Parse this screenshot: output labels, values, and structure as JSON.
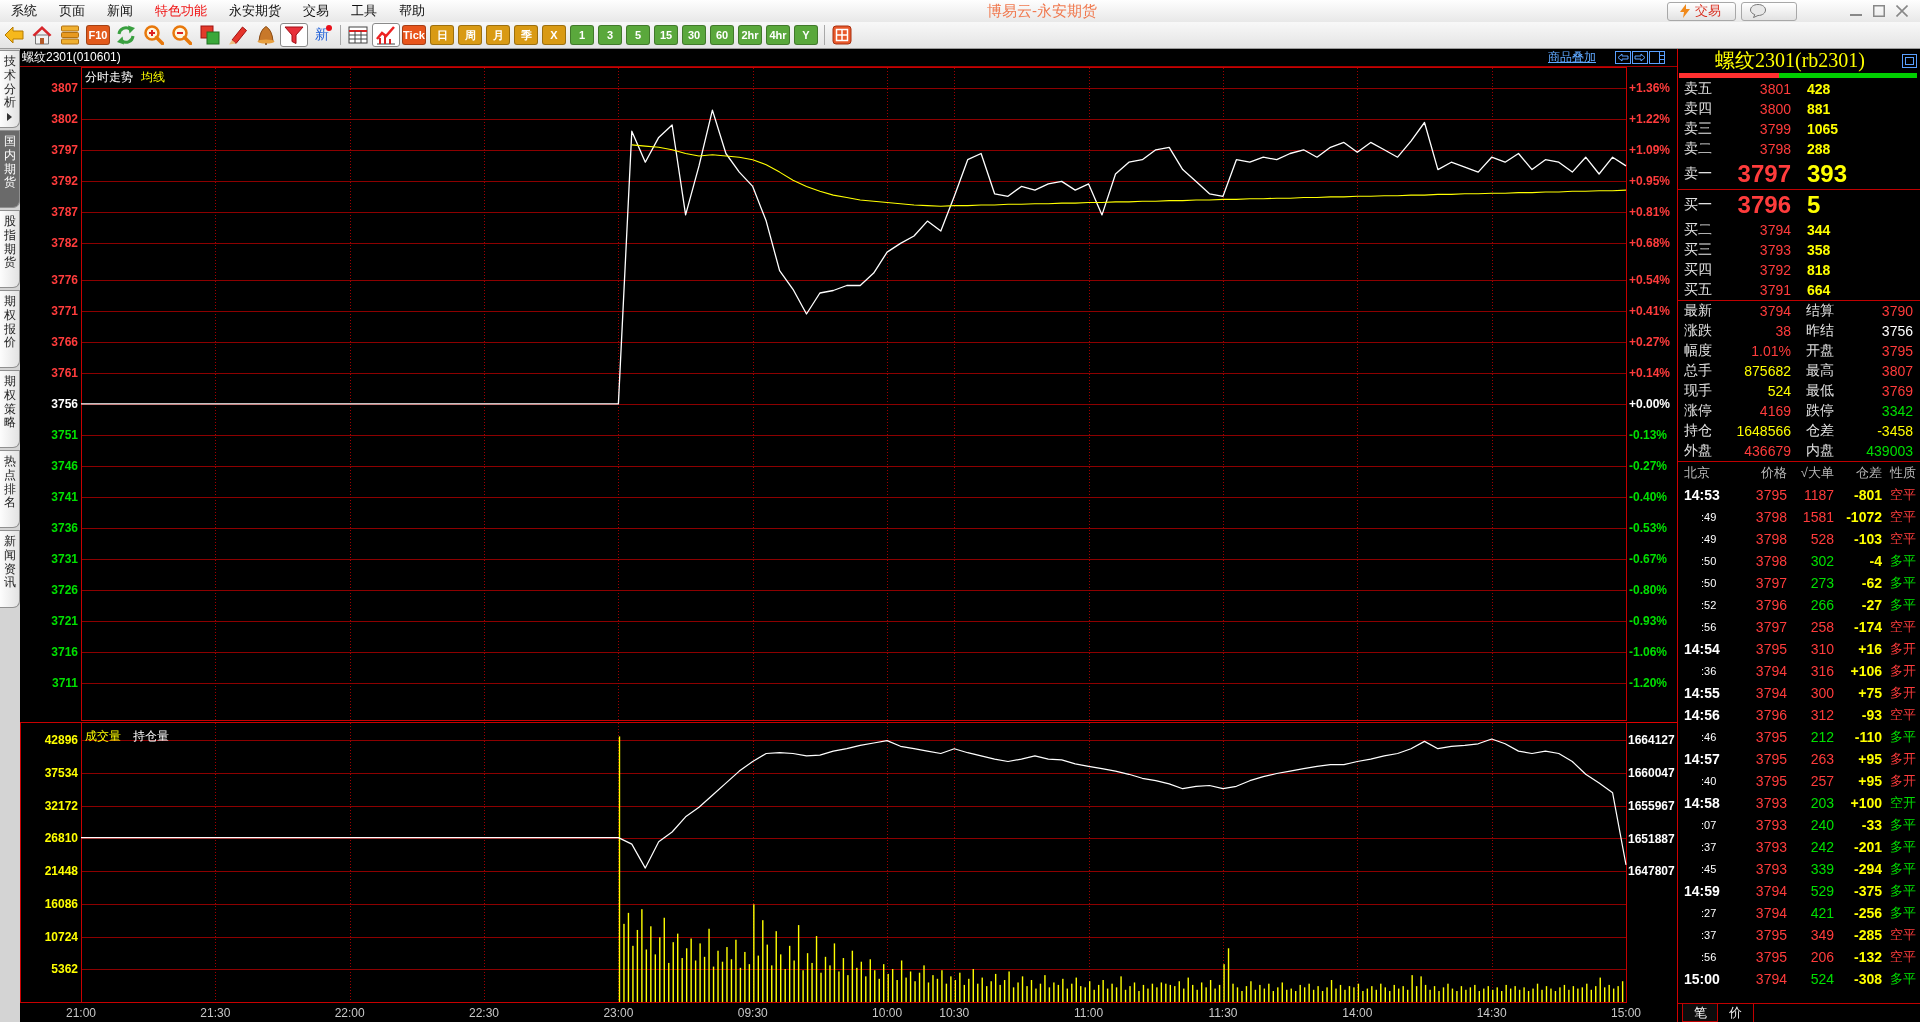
{
  "menu_bar": {
    "items": [
      {
        "label": "系统",
        "highlighted": false
      },
      {
        "label": "页面",
        "highlighted": false
      },
      {
        "label": "新闻",
        "highlighted": false
      },
      {
        "label": "特色功能",
        "highlighted": true
      },
      {
        "label": "永安期货",
        "highlighted": false
      },
      {
        "label": "交易",
        "highlighted": false
      },
      {
        "label": "工具",
        "highlighted": false
      },
      {
        "label": "帮助",
        "highlighted": false
      }
    ],
    "app_title": "博易云-永安期货",
    "trade_button": "交易"
  },
  "toolbar": {
    "groups": [
      [
        {
          "kind": "back",
          "selected": false
        },
        {
          "kind": "home",
          "selected": false
        },
        {
          "kind": "books",
          "selected": false
        },
        {
          "kind": "tile",
          "label": "F10",
          "color": "#e25a1c",
          "selected": false
        },
        {
          "kind": "refresh",
          "selected": false
        },
        {
          "kind": "zoomin",
          "selected": false
        },
        {
          "kind": "zoomout",
          "selected": false
        },
        {
          "kind": "windows",
          "selected": false
        },
        {
          "kind": "pen",
          "selected": false
        },
        {
          "kind": "bell",
          "selected": false
        },
        {
          "kind": "filter",
          "selected": true
        },
        {
          "kind": "news",
          "label": "新",
          "badge": true,
          "selected": false
        }
      ],
      [
        {
          "kind": "table",
          "selected": false
        },
        {
          "kind": "chart",
          "selected": true
        },
        {
          "kind": "tile",
          "label": "Tick",
          "color": "#e8551c",
          "selected": false
        },
        {
          "kind": "tile",
          "label": "日",
          "color": "#d99a14",
          "selected": false
        },
        {
          "kind": "tile",
          "label": "周",
          "color": "#d99a14",
          "selected": false
        },
        {
          "kind": "tile",
          "label": "月",
          "color": "#d99a14",
          "selected": false
        },
        {
          "kind": "tile",
          "label": "季",
          "color": "#d99a14",
          "selected": false
        },
        {
          "kind": "tile",
          "label": "X",
          "color": "#d99a14",
          "selected": false
        },
        {
          "kind": "tile",
          "label": "1",
          "color": "#5aa83c",
          "selected": false
        },
        {
          "kind": "tile",
          "label": "3",
          "color": "#5aa83c",
          "selected": false
        },
        {
          "kind": "tile",
          "label": "5",
          "color": "#5aa83c",
          "selected": false
        },
        {
          "kind": "tile",
          "label": "15",
          "color": "#5aa83c",
          "selected": false
        },
        {
          "kind": "tile",
          "label": "30",
          "color": "#5aa83c",
          "selected": false
        },
        {
          "kind": "tile",
          "label": "60",
          "color": "#5aa83c",
          "selected": false
        },
        {
          "kind": "tile",
          "label": "2hr",
          "color": "#5aa83c",
          "selected": false
        },
        {
          "kind": "tile",
          "label": "4hr",
          "color": "#5aa83c",
          "selected": false
        },
        {
          "kind": "tile",
          "label": "Y",
          "color": "#5aa83c",
          "selected": false
        }
      ],
      [
        {
          "kind": "grid",
          "selected": false
        }
      ]
    ]
  },
  "side_tabs": [
    {
      "label": "技术分析",
      "selected": false,
      "has_arrow": true
    },
    {
      "label": "国内期货",
      "selected": true,
      "has_arrow": false
    },
    {
      "label": "股指期货",
      "selected": false,
      "has_arrow": false
    },
    {
      "label": "期权报价",
      "selected": false,
      "has_arrow": false
    },
    {
      "label": "期权策略",
      "selected": false,
      "has_arrow": false
    },
    {
      "label": "热点排名",
      "selected": false,
      "has_arrow": false
    },
    {
      "label": "新闻资讯",
      "selected": false,
      "has_arrow": false
    }
  ],
  "chart_header": {
    "title": "螺纹2301(010601)",
    "overlay_link": "商品叠加"
  },
  "price_chart": {
    "chart_data": {
      "type": "line",
      "grid": true,
      "ylim": [
        3705,
        3810.2
      ],
      "yticks": [
        3807,
        3802,
        3797,
        3792,
        3787,
        3782,
        3776,
        3771,
        3766,
        3761,
        3756,
        3751,
        3746,
        3741,
        3736,
        3731,
        3726,
        3721,
        3716,
        3711
      ],
      "categories": [
        null,
        null,
        null,
        null,
        null,
        null,
        null,
        null,
        null,
        null,
        null,
        null,
        null,
        null,
        null,
        null,
        null,
        null,
        null,
        null,
        null,
        null,
        null,
        null,
        null,
        null,
        null,
        null,
        null,
        null,
        null,
        null,
        null,
        null,
        null,
        null,
        null,
        null,
        null,
        null,
        null,
        null,
        null,
        null,
        null,
        null,
        null,
        null,
        null,
        null,
        null,
        null,
        null,
        null,
        null,
        null,
        null,
        null,
        null,
        null,
        null,
        null,
        null,
        null,
        null,
        null,
        null,
        null,
        null,
        null,
        null,
        null,
        null,
        null,
        null,
        null,
        null,
        null,
        null,
        null,
        null,
        null,
        null,
        null,
        null,
        null,
        null,
        null,
        null,
        null,
        null,
        null,
        null,
        null,
        null,
        null,
        null,
        null,
        null,
        null,
        null,
        null,
        null,
        null,
        null,
        null,
        null,
        null,
        null,
        null,
        null,
        null,
        null,
        null,
        null,
        null
      ],
      "series": [
        {
          "name": "分时走势",
          "color": "#ffffff",
          "values": [
            3756,
            3756,
            3756,
            3756,
            3756,
            3756,
            3756,
            3756,
            3756,
            3756,
            3756,
            3756,
            3756,
            3756,
            3756,
            3756,
            3756,
            3756,
            3756,
            3756,
            3756,
            3756,
            3756,
            3756,
            3756,
            3756,
            3756,
            3756,
            3756,
            3756,
            3756,
            3756,
            3756,
            3756,
            3756,
            3756,
            3756,
            3756,
            3756,
            3756,
            3756,
            3800.0,
            3795.0,
            3799.0,
            3801.0,
            3786.5,
            3794.4,
            3803.4,
            3796.4,
            3793.4,
            3791.1,
            3785.5,
            3777.5,
            3774.5,
            3770.5,
            3773.9,
            3774.3,
            3775.1,
            3775.1,
            3777.1,
            3780.5,
            3781.9,
            3783.1,
            3785.5,
            3783.9,
            3789.5,
            3795.4,
            3796.4,
            3789.9,
            3789.5,
            3791.1,
            3790.5,
            3791.5,
            3791.9,
            3790.5,
            3791.5,
            3786.5,
            3793.1,
            3795.0,
            3795.4,
            3797.0,
            3797.4,
            3793.8,
            3791.9,
            3789.9,
            3789.5,
            3795.4,
            3795.0,
            3795.8,
            3795.4,
            3796.4,
            3797.0,
            3795.8,
            3797.4,
            3798.2,
            3796.6,
            3798.2,
            3797.0,
            3795.8,
            3798.4,
            3801.4,
            3793.8,
            3795.0,
            3794.2,
            3793.4,
            3795.8,
            3795.0,
            3796.4,
            3793.8,
            3795.4,
            3795.0,
            3793.4,
            3795.8,
            3793.1,
            3795.8,
            3794.4
          ]
        },
        {
          "name": "均线",
          "color": "#ffff00",
          "values": [
            null,
            null,
            null,
            null,
            null,
            null,
            null,
            null,
            null,
            null,
            null,
            null,
            null,
            null,
            null,
            null,
            null,
            null,
            null,
            null,
            null,
            null,
            null,
            null,
            null,
            null,
            null,
            null,
            null,
            null,
            null,
            null,
            null,
            null,
            null,
            null,
            null,
            null,
            null,
            null,
            null,
            3797.8,
            3797.6,
            3797.4,
            3797.0,
            3796.4,
            3796.0,
            3796.2,
            3796.0,
            3795.8,
            3795.4,
            3794.6,
            3793.4,
            3792.1,
            3791.1,
            3790.3,
            3789.7,
            3789.3,
            3788.9,
            3788.7,
            3788.5,
            3788.3,
            3788.1,
            3788.0,
            3787.9,
            3788.0,
            3788.0,
            3788.1,
            3788.1,
            3788.2,
            3788.2,
            3788.3,
            3788.3,
            3788.4,
            3788.4,
            3788.5,
            3788.5,
            3788.6,
            3788.6,
            3788.7,
            3788.7,
            3788.8,
            3788.8,
            3788.9,
            3788.9,
            3789.0,
            3789.0,
            3789.1,
            3789.1,
            3789.2,
            3789.2,
            3789.3,
            3789.3,
            3789.4,
            3789.4,
            3789.5,
            3789.5,
            3789.6,
            3789.6,
            3789.7,
            3789.7,
            3789.8,
            3789.8,
            3789.9,
            3789.9,
            3790.0,
            3790.0,
            3790.1,
            3790.1,
            3790.2,
            3790.2,
            3790.3,
            3790.3,
            3790.4,
            3790.4,
            3790.5
          ]
        }
      ]
    },
    "percent_axis": [
      {
        "label": "+1.36%",
        "color": "#ff3c3c"
      },
      {
        "label": "+1.22%",
        "color": "#ff3c3c"
      },
      {
        "label": "+1.09%",
        "color": "#ff3c3c"
      },
      {
        "label": "+0.95%",
        "color": "#ff3c3c"
      },
      {
        "label": "+0.81%",
        "color": "#ff3c3c"
      },
      {
        "label": "+0.68%",
        "color": "#ff3c3c"
      },
      {
        "label": "+0.54%",
        "color": "#ff3c3c"
      },
      {
        "label": "+0.41%",
        "color": "#ff3c3c"
      },
      {
        "label": "+0.27%",
        "color": "#ff3c3c"
      },
      {
        "label": "+0.14%",
        "color": "#ff3c3c"
      },
      {
        "label": "+0.00%",
        "color": "#ffffff"
      },
      {
        "label": "-0.13%",
        "color": "#00e000"
      },
      {
        "label": "-0.27%",
        "color": "#00e000"
      },
      {
        "label": "-0.40%",
        "color": "#00e000"
      },
      {
        "label": "-0.53%",
        "color": "#00e000"
      },
      {
        "label": "-0.67%",
        "color": "#00e000"
      },
      {
        "label": "-0.80%",
        "color": "#00e000"
      },
      {
        "label": "-0.93%",
        "color": "#00e000"
      },
      {
        "label": "-1.06%",
        "color": "#00e000"
      },
      {
        "label": "-1.20%",
        "color": "#00e000"
      }
    ]
  },
  "volume_chart": {
    "chart_data": {
      "type": "bar",
      "grid": true,
      "ylim": [
        0,
        45700
      ],
      "categories": [
        "21:00",
        null,
        null,
        null,
        null,
        null,
        null,
        null,
        null,
        null,
        null,
        null,
        null,
        null,
        null,
        null,
        null,
        null,
        null,
        null,
        null,
        null,
        null,
        null,
        null,
        null,
        null,
        null,
        null,
        null,
        "21:30",
        null,
        null,
        null,
        null,
        null,
        null,
        null,
        null,
        null,
        null,
        null,
        null,
        null,
        null,
        null,
        null,
        null,
        null,
        null,
        null,
        null,
        null,
        null,
        null,
        null,
        null,
        null,
        null,
        null,
        "22:00",
        null,
        null,
        null,
        null,
        null,
        null,
        null,
        null,
        null,
        null,
        null,
        null,
        null,
        null,
        null,
        null,
        null,
        null,
        null,
        null,
        null,
        null,
        null,
        null,
        null,
        null,
        null,
        null,
        null,
        "22:30",
        null,
        null,
        null,
        null,
        null,
        null,
        null,
        null,
        null,
        null,
        null,
        null,
        null,
        null,
        null,
        null,
        null,
        null,
        null,
        null,
        null,
        null,
        null,
        null,
        null,
        null,
        null,
        null,
        null,
        "23:00",
        null,
        null,
        null,
        null,
        null,
        null,
        null,
        null,
        null,
        null,
        null,
        null,
        null,
        null,
        null,
        null,
        null,
        null,
        null,
        null,
        null,
        null,
        null,
        null,
        null,
        null,
        null,
        null,
        null,
        "09:30",
        null,
        null,
        null,
        null,
        null,
        null,
        null,
        null,
        null,
        null,
        null,
        null,
        null,
        null,
        null,
        null,
        null,
        null,
        null,
        null,
        null,
        null,
        null,
        null,
        null,
        null,
        null,
        null,
        null,
        "10:00",
        null,
        null,
        null,
        null,
        null,
        null,
        null,
        null,
        null,
        null,
        null,
        null,
        null,
        null,
        "10:30",
        null,
        null,
        null,
        null,
        null,
        null,
        null,
        null,
        null,
        null,
        null,
        null,
        null,
        null,
        null,
        null,
        null,
        null,
        null,
        null,
        null,
        null,
        null,
        null,
        null,
        null,
        null,
        null,
        null,
        "11:00",
        null,
        null,
        null,
        null,
        null,
        null,
        null,
        null,
        null,
        null,
        null,
        null,
        null,
        null,
        null,
        null,
        null,
        null,
        null,
        null,
        null,
        null,
        null,
        null,
        null,
        null,
        null,
        null,
        null,
        "11:30",
        null,
        null,
        null,
        null,
        null,
        null,
        null,
        null,
        null,
        null,
        null,
        null,
        null,
        null,
        null,
        null,
        null,
        null,
        null,
        null,
        null,
        null,
        null,
        null,
        null,
        null,
        null,
        null,
        null,
        "14:00",
        null,
        null,
        null,
        null,
        null,
        null,
        null,
        null,
        null,
        null,
        null,
        null,
        null,
        null,
        null,
        null,
        null,
        null,
        null,
        null,
        null,
        null,
        null,
        null,
        null,
        null,
        null,
        null,
        null,
        "14:30",
        null,
        null,
        null,
        null,
        null,
        null,
        null,
        null,
        null,
        null,
        null,
        null,
        null,
        null,
        null,
        null,
        null,
        null,
        null,
        null,
        null,
        null,
        null,
        null,
        null,
        null,
        null,
        null,
        null,
        "15:00"
      ],
      "yticks": [
        42896,
        37534,
        32172,
        26810,
        21448,
        16086,
        10724,
        5362
      ],
      "series": [
        {
          "name": "成交量",
          "color": "#ffff00",
          "values": [
            null,
            null,
            null,
            null,
            null,
            null,
            null,
            null,
            null,
            null,
            null,
            null,
            null,
            null,
            null,
            null,
            null,
            null,
            null,
            null,
            null,
            null,
            null,
            null,
            null,
            null,
            null,
            null,
            null,
            null,
            null,
            null,
            null,
            null,
            null,
            null,
            null,
            null,
            null,
            null,
            null,
            null,
            null,
            null,
            null,
            null,
            null,
            null,
            null,
            null,
            null,
            null,
            null,
            null,
            null,
            null,
            null,
            null,
            null,
            null,
            null,
            null,
            null,
            null,
            null,
            null,
            null,
            null,
            null,
            null,
            null,
            null,
            null,
            null,
            null,
            null,
            null,
            null,
            null,
            null,
            null,
            null,
            null,
            null,
            null,
            null,
            null,
            null,
            null,
            null,
            null,
            null,
            null,
            null,
            null,
            null,
            null,
            null,
            null,
            null,
            null,
            null,
            null,
            null,
            null,
            null,
            null,
            null,
            null,
            null,
            null,
            null,
            null,
            null,
            null,
            null,
            null,
            null,
            null,
            null,
            43500,
            12800,
            14600,
            9200,
            11800,
            15200,
            8600,
            12400,
            7800,
            10600,
            13800,
            6400,
            9800,
            11200,
            7200,
            8800,
            10400,
            6800,
            9600,
            7400,
            12000,
            5800,
            8400,
            6600,
            9000,
            7000,
            10200,
            5600,
            8200,
            6200,
            16000,
            7600,
            13400,
            9400,
            6000,
            11600,
            7800,
            5400,
            9200,
            6800,
            12600,
            5200,
            8000,
            6400,
            10800,
            4800,
            7400,
            6000,
            9600,
            5000,
            7200,
            4400,
            8400,
            5600,
            6600,
            4200,
            7000,
            5200,
            3800,
            6200,
            4600,
            5400,
            3600,
            6800,
            4000,
            5000,
            3400,
            4800,
            6000,
            3200,
            4400,
            3800,
            5200,
            3000,
            4200,
            3600,
            4800,
            2800,
            3800,
            5400,
            3000,
            4000,
            2600,
            3400,
            4600,
            2800,
            3600,
            5000,
            2400,
            3200,
            4200,
            2600,
            3600,
            2200,
            3000,
            4400,
            2400,
            3200,
            2800,
            3800,
            2200,
            3000,
            4000,
            2600,
            2400,
            3400,
            2000,
            2800,
            3600,
            2200,
            3000,
            2400,
            4200,
            2000,
            2600,
            3200,
            1800,
            2800,
            2200,
            3000,
            2400,
            3200,
            3000,
            2800,
            2600,
            3400,
            2200,
            4000,
            2800,
            2000,
            3200,
            2400,
            3600,
            2200,
            2800,
            6200,
            8800,
            3000,
            2400,
            1800,
            2600,
            3400,
            2000,
            2800,
            2200,
            3000,
            1800,
            2400,
            3200,
            2000,
            2200,
            1800,
            2800,
            2400,
            3000,
            2000,
            2600,
            1800,
            2400,
            3600,
            2200,
            2800,
            2000,
            2600,
            2400,
            3000,
            1800,
            2200,
            2600,
            2000,
            3000,
            2400,
            1800,
            2800,
            2200,
            2600,
            2000,
            4400,
            2600,
            4200,
            2800,
            2000,
            2600,
            1800,
            2400,
            3000,
            2200,
            1800,
            2600,
            2000,
            2400,
            2800,
            1800,
            2200,
            2600,
            2000,
            2400,
            1800,
            2800,
            2200,
            2600,
            2000,
            2400,
            1800,
            2200,
            3000,
            2000,
            2600,
            2200,
            1800,
            2400,
            2800,
            2000,
            2600,
            2200,
            2400,
            3000,
            2000,
            2600,
            4000,
            2400,
            2800,
            2200,
            2600,
            3400,
            null
          ]
        }
      ]
    },
    "open_interest": {
      "chart_data": {
        "type": "line",
        "ylim": [
          1631500,
          1666300
        ],
        "yticks": [
          1664127,
          1660047,
          1655967,
          1651887,
          1647807
        ],
        "categories": [
          null,
          null,
          null,
          null,
          null,
          null,
          null,
          null,
          null,
          null,
          null,
          null,
          null,
          null,
          null,
          null,
          null,
          null,
          null,
          null,
          null,
          null,
          null,
          null,
          null,
          null,
          null,
          null,
          null,
          null,
          null,
          null,
          null,
          null,
          null,
          null,
          null,
          null,
          null,
          null,
          null,
          null,
          null,
          null,
          null,
          null,
          null,
          null,
          null,
          null,
          null,
          null,
          null,
          null,
          null,
          null,
          null,
          null,
          null,
          null,
          null,
          null,
          null,
          null,
          null,
          null,
          null,
          null,
          null,
          null,
          null,
          null,
          null,
          null,
          null,
          null,
          null,
          null,
          null,
          null,
          null,
          null,
          null,
          null,
          null,
          null,
          null,
          null,
          null,
          null,
          null,
          null,
          null,
          null,
          null,
          null,
          null,
          null,
          null,
          null,
          null,
          null,
          null,
          null,
          null,
          null,
          null,
          null,
          null,
          null,
          null,
          null,
          null,
          null,
          null,
          null
        ],
        "series": [
          {
            "name": "持仓量",
            "color": "#ffffff",
            "values": [
              1652000,
              1652000,
              1652000,
              1652000,
              1652000,
              1652000,
              1652000,
              1652000,
              1652000,
              1652000,
              1652000,
              1652000,
              1652000,
              1652000,
              1652000,
              1652000,
              1652000,
              1652000,
              1652000,
              1652000,
              1652000,
              1652000,
              1652000,
              1652000,
              1652000,
              1652000,
              1652000,
              1652000,
              1652000,
              1652000,
              1652000,
              1652000,
              1652000,
              1652000,
              1652000,
              1652000,
              1652000,
              1652000,
              1652000,
              1652000,
              1652000,
              1651200,
              1648200,
              1651500,
              1652700,
              1654600,
              1655800,
              1657300,
              1658800,
              1660300,
              1661500,
              1662500,
              1662600,
              1662500,
              1662200,
              1662300,
              1662800,
              1663100,
              1663500,
              1663800,
              1664100,
              1663400,
              1663100,
              1662800,
              1662500,
              1663100,
              1662600,
              1662200,
              1661800,
              1661500,
              1661800,
              1662200,
              1661800,
              1661700,
              1661200,
              1660900,
              1660600,
              1660300,
              1659900,
              1659400,
              1659100,
              1658700,
              1658100,
              1658400,
              1658500,
              1658100,
              1658400,
              1659100,
              1659600,
              1660000,
              1660300,
              1660600,
              1660900,
              1661100,
              1661100,
              1661500,
              1661800,
              1662200,
              1662500,
              1663100,
              1664000,
              1663100,
              1663400,
              1663500,
              1663700,
              1664300,
              1663700,
              1662800,
              1662500,
              1662800,
              1662500,
              1661500,
              1659900,
              1658800,
              1657600,
              1648600
            ]
          }
        ]
      }
    }
  },
  "quote_panel": {
    "title": "螺纹2301(rb2301)",
    "ratio_bar": {
      "level": 0.42
    },
    "asks": [
      {
        "label": "卖五",
        "price": "3801",
        "volume": "428",
        "kind": "depth"
      },
      {
        "label": "卖四",
        "price": "3800",
        "volume": "881",
        "kind": "depth"
      },
      {
        "label": "卖三",
        "price": "3799",
        "volume": "1065",
        "kind": "depth"
      },
      {
        "label": "卖二",
        "price": "3798",
        "volume": "288",
        "kind": "depth"
      },
      {
        "label": "卖一",
        "price": "3797",
        "volume": "393",
        "kind": "best"
      }
    ],
    "bids": [
      {
        "label": "买一",
        "price": "3796",
        "volume": "5",
        "kind": "best"
      },
      {
        "label": "买二",
        "price": "3794",
        "volume": "344",
        "kind": "depth"
      },
      {
        "label": "买三",
        "price": "3793",
        "volume": "358",
        "kind": "depth"
      },
      {
        "label": "买四",
        "price": "3792",
        "volume": "818",
        "kind": "depth"
      },
      {
        "label": "买五",
        "price": "3791",
        "volume": "664",
        "kind": "depth"
      }
    ],
    "stats": [
      {
        "label": "最新",
        "value": "3794",
        "color": "#ff3c3c"
      },
      {
        "label": "结算",
        "value": "3790",
        "color": "#ff3c3c"
      },
      {
        "label": "涨跌",
        "value": "38",
        "color": "#ff3c3c"
      },
      {
        "label": "昨结",
        "value": "3756",
        "color": "#ffffff"
      },
      {
        "label": "幅度",
        "value": "1.01%",
        "color": "#ff3c3c"
      },
      {
        "label": "开盘",
        "value": "3795",
        "color": "#ff3c3c"
      },
      {
        "label": "总手",
        "value": "875682",
        "color": "#ffff00"
      },
      {
        "label": "最高",
        "value": "3807",
        "color": "#ff3c3c"
      },
      {
        "label": "现手",
        "value": "524",
        "color": "#ffff00"
      },
      {
        "label": "最低",
        "value": "3769",
        "color": "#ff3c3c"
      },
      {
        "label": "涨停",
        "value": "4169",
        "color": "#ff3c3c"
      },
      {
        "label": "跌停",
        "value": "3342",
        "color": "#00e000"
      },
      {
        "label": "持仓",
        "value": "1648566",
        "color": "#ffff00"
      },
      {
        "label": "仓差",
        "value": "-3458",
        "color": "#ffff00"
      },
      {
        "label": "外盘",
        "value": "436679",
        "color": "#ff3c3c"
      },
      {
        "label": "内盘",
        "value": "439003",
        "color": "#00e000"
      }
    ],
    "trades": {
      "columns": [
        "北京",
        "价格",
        "√大单",
        "仓差",
        "性质"
      ],
      "rows": [
        {
          "time": "14:53",
          "kind": "minute",
          "price": "3795",
          "volume": "1187",
          "oi_change": "-801",
          "nature": "空平",
          "color": "#ff3c3c"
        },
        {
          "time": ":49",
          "kind": "second",
          "price": "3798",
          "volume": "1581",
          "oi_change": "-1072",
          "nature": "空平",
          "color": "#ff3c3c"
        },
        {
          "time": ":49",
          "kind": "second",
          "price": "3798",
          "volume": "528",
          "oi_change": "-103",
          "nature": "空平",
          "color": "#ff3c3c"
        },
        {
          "time": ":50",
          "kind": "second",
          "price": "3798",
          "volume": "302",
          "oi_change": "-4",
          "nature": "多平",
          "color": "#00e000"
        },
        {
          "time": ":50",
          "kind": "second",
          "price": "3797",
          "volume": "273",
          "oi_change": "-62",
          "nature": "多平",
          "color": "#00e000"
        },
        {
          "time": ":52",
          "kind": "second",
          "price": "3796",
          "volume": "266",
          "oi_change": "-27",
          "nature": "多平",
          "color": "#00e000"
        },
        {
          "time": ":56",
          "kind": "second",
          "price": "3797",
          "volume": "258",
          "oi_change": "-174",
          "nature": "空平",
          "color": "#ff3c3c"
        },
        {
          "time": "14:54",
          "kind": "minute",
          "price": "3795",
          "volume": "310",
          "oi_change": "+16",
          "nature": "多开",
          "color": "#ff3c3c"
        },
        {
          "time": ":36",
          "kind": "second",
          "price": "3794",
          "volume": "316",
          "oi_change": "+106",
          "nature": "多开",
          "color": "#ff3c3c"
        },
        {
          "time": "14:55",
          "kind": "minute",
          "price": "3794",
          "volume": "300",
          "oi_change": "+75",
          "nature": "多开",
          "color": "#ff3c3c"
        },
        {
          "time": "14:56",
          "kind": "minute",
          "price": "3796",
          "volume": "312",
          "oi_change": "-93",
          "nature": "空平",
          "color": "#ff3c3c"
        },
        {
          "time": ":46",
          "kind": "second",
          "price": "3795",
          "volume": "212",
          "oi_change": "-110",
          "nature": "多平",
          "color": "#00e000"
        },
        {
          "time": "14:57",
          "kind": "minute",
          "price": "3795",
          "volume": "263",
          "oi_change": "+95",
          "nature": "多开",
          "color": "#ff3c3c"
        },
        {
          "time": ":40",
          "kind": "second",
          "price": "3795",
          "volume": "257",
          "oi_change": "+95",
          "nature": "多开",
          "color": "#ff3c3c"
        },
        {
          "time": "14:58",
          "kind": "minute",
          "price": "3793",
          "volume": "203",
          "oi_change": "+100",
          "nature": "空开",
          "color": "#00e000"
        },
        {
          "time": ":07",
          "kind": "second",
          "price": "3793",
          "volume": "240",
          "oi_change": "-33",
          "nature": "多平",
          "color": "#00e000"
        },
        {
          "time": ":37",
          "kind": "second",
          "price": "3793",
          "volume": "242",
          "oi_change": "-201",
          "nature": "多平",
          "color": "#00e000"
        },
        {
          "time": ":45",
          "kind": "second",
          "price": "3793",
          "volume": "339",
          "oi_change": "-294",
          "nature": "多平",
          "color": "#00e000"
        },
        {
          "time": "14:59",
          "kind": "minute",
          "price": "3794",
          "volume": "529",
          "oi_change": "-375",
          "nature": "多平",
          "color": "#00e000"
        },
        {
          "time": ":27",
          "kind": "second",
          "price": "3794",
          "volume": "421",
          "oi_change": "-256",
          "nature": "多平",
          "color": "#00e000"
        },
        {
          "time": ":37",
          "kind": "second",
          "price": "3795",
          "volume": "349",
          "oi_change": "-285",
          "nature": "空平",
          "color": "#ff3c3c"
        },
        {
          "time": ":56",
          "kind": "second",
          "price": "3795",
          "volume": "206",
          "oi_change": "-132",
          "nature": "空平",
          "color": "#ff3c3c"
        },
        {
          "time": "15:00",
          "kind": "minute",
          "price": "3794",
          "volume": "524",
          "oi_change": "-308",
          "nature": "多平",
          "color": "#00e000"
        }
      ]
    },
    "bottom_tabs": [
      {
        "label": "笔",
        "selected": true
      },
      {
        "label": "价",
        "selected": false
      }
    ]
  }
}
